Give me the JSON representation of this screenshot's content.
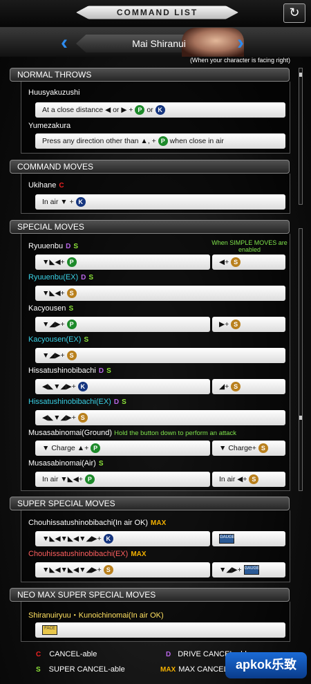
{
  "header": {
    "title": "COMMAND LIST",
    "back_icon": "↻"
  },
  "character": {
    "name": "Mai Shiranui",
    "prev_icon": "‹",
    "next_icon": "›"
  },
  "facing_note": "(When your character is facing right)",
  "sections": {
    "normal_throws": "NORMAL THROWS",
    "command_moves": "COMMAND MOVES",
    "special_moves": "SPECIAL MOVES",
    "super_special_moves": "SUPER SPECIAL MOVES",
    "neo_max": "NEO MAX SUPER SPECIAL MOVES"
  },
  "moves": {
    "huusyakuzushi": {
      "name": "Huusyakuzushi",
      "text1": "At a close distance",
      "dir1": "◀",
      "or1": "or",
      "dir2": "▶",
      "plus": "+",
      "btn1": "P",
      "or2": "or",
      "btn2": "K"
    },
    "yumezakura": {
      "name": "Yumezakura",
      "text1": "Press any direction other than",
      "dir": "▲",
      "sep": ", +",
      "btn": "P",
      "text2": "when close in air"
    },
    "ukihane": {
      "name": "Ukihane",
      "tag": "C",
      "text": "In air",
      "dir": "▼",
      "plus": "+",
      "btn": "K"
    },
    "ryuuenbu": {
      "name": "Ryuuenbu",
      "tag1": "D",
      "tag2": "S",
      "dirs": "▼◣◀",
      "plus": "+",
      "btn": "P",
      "simple_note": "When SIMPLE MOVES are enabled",
      "simple_dir": "◀",
      "simple_plus": "+",
      "simple_btn": "S"
    },
    "ryuuenbu_ex": {
      "name": "Ryuuenbu(EX)",
      "tag1": "D",
      "tag2": "S",
      "dirs": "▼◣◀",
      "plus": "+",
      "btn": "S"
    },
    "kacyousen": {
      "name": "Kacyousen",
      "tag": "S",
      "dirs": "▼◢▶",
      "plus": "+",
      "btn": "P",
      "simple_dir": "▶",
      "simple_plus": "+",
      "simple_btn": "S"
    },
    "kacyousen_ex": {
      "name": "Kacyousen(EX)",
      "tag": "S",
      "dirs": "▼◢▶",
      "plus": "+",
      "btn": "S"
    },
    "hissatu": {
      "name": "Hissatushinobibachi",
      "tag1": "D",
      "tag2": "S",
      "dirs": "◀◣▼◢▶",
      "plus": "+",
      "btn": "K",
      "simple_dir": "◢",
      "simple_plus": "+",
      "simple_btn": "S"
    },
    "hissatu_ex": {
      "name": "Hissatushinobibachi(EX)",
      "tag1": "D",
      "tag2": "S",
      "dirs": "◀◣▼◢▶",
      "plus": "+",
      "btn": "S"
    },
    "musasabi_ground": {
      "name": "Musasabinomai(Ground)",
      "hint": "Hold the button down to perform an attack",
      "dir1": "▼",
      "charge": "Charge",
      "dir2": "▲",
      "plus": "+",
      "btn": "P",
      "simple_dir": "▼",
      "simple_charge": "Charge",
      "simple_plus": "+",
      "simple_btn": "S"
    },
    "musasabi_air": {
      "name": "Musasabinomai(Air)",
      "tag": "S",
      "text": "In air",
      "dirs": "▼◣◀",
      "plus": "+",
      "btn": "P",
      "simple_text": "In air",
      "simple_dir": "◀",
      "simple_plus": "+",
      "simple_btn": "S"
    },
    "chouhissa": {
      "name": "Chouhissatushinobibachi(In air OK)",
      "tag": "MAX",
      "dirs": "▼◣◀▼◣◀▼◢▶",
      "plus": "+",
      "btn": "K",
      "gauge": "GAUGE"
    },
    "chouhissa_ex": {
      "name": "Chouhissatushinobibachi(EX)",
      "tag": "MAX",
      "dirs": "▼◣◀▼◣◀▼◢▶",
      "plus": "+",
      "btn": "S",
      "simple_dirs": "▼◢▶",
      "simple_plus": "+",
      "gauge": "GAUGE"
    },
    "neo": {
      "name": "Shiranuiryuu・Kunoichinomai(In air OK)",
      "face": "FACE"
    }
  },
  "legend": {
    "cancel_tag": "C",
    "cancel": "CANCEL-able",
    "drive_tag": "D",
    "drive": "DRIVE CANCEL-able",
    "super_tag": "S",
    "super": "SUPER CANCEL-able",
    "max_tag": "MAX",
    "max": "MAX CANCEL-able"
  },
  "watermark": "apkok乐致",
  "colors": {
    "punch": "#1d8a2a",
    "kick": "#15357f",
    "simple": "#b9801d",
    "accent": "#2e8cf0"
  }
}
